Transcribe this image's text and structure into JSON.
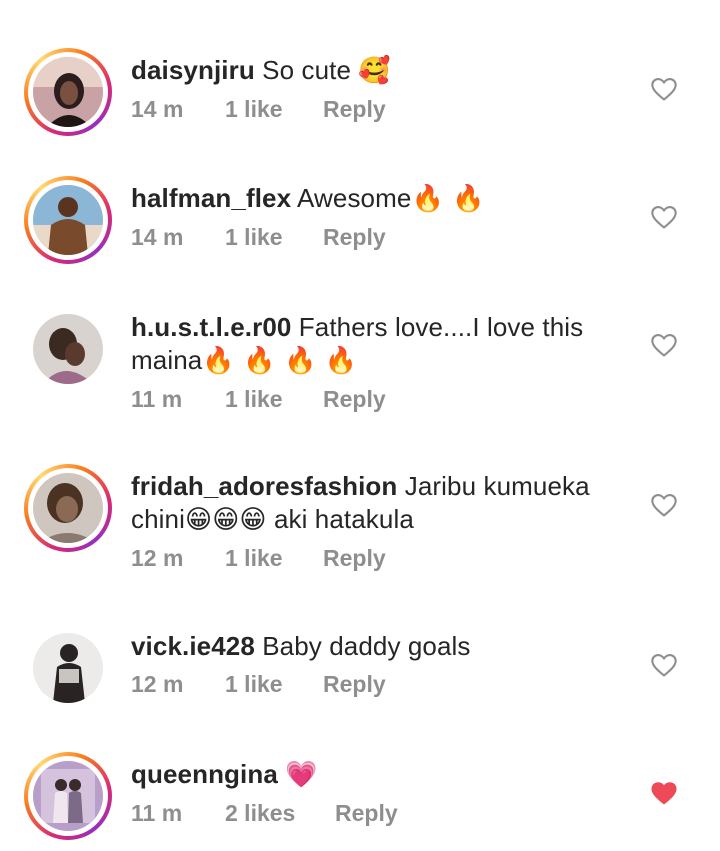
{
  "comments": [
    {
      "username": "daisynjiru",
      "text": "So cute",
      "emoji": "🥰",
      "time": "14 m",
      "likes": "1 like",
      "reply": "Reply",
      "liked": false,
      "avatar_ring": true,
      "avatar_colors": [
        "#c9a2a5",
        "#2b1d1d",
        "#e6d0c8"
      ]
    },
    {
      "username": "halfman_flex",
      "text": "Awesome",
      "emoji": "🔥 🔥",
      "time": "14 m",
      "likes": "1 like",
      "reply": "Reply",
      "liked": false,
      "avatar_ring": true,
      "avatar_colors": [
        "#8bb6d6",
        "#7a4a2c",
        "#e8d9c8"
      ]
    },
    {
      "username": "h.u.s.t.l.e.r00",
      "text": "Fathers love....I love this",
      "text_line2": "maina",
      "emoji": "🔥 🔥 🔥 🔥",
      "time": "11 m",
      "likes": "1 like",
      "reply": "Reply",
      "liked": false,
      "avatar_ring": false,
      "avatar_colors": [
        "#d9d3cf",
        "#3a2a22",
        "#9c6b8a"
      ]
    },
    {
      "username": "fridah_adoresfashion",
      "text": "Jaribu kumueka",
      "text_line2": "chini",
      "emoji": "😁😁😁",
      "text_tail": "aki hatakula",
      "time": "12 m",
      "likes": "1 like",
      "reply": "Reply",
      "liked": false,
      "avatar_ring": true,
      "avatar_colors": [
        "#cfc6bf",
        "#4a3322",
        "#8a7a70"
      ]
    },
    {
      "username": "vick.ie428",
      "text": "Baby daddy goals",
      "time": "12 m",
      "likes": "1 like",
      "reply": "Reply",
      "liked": false,
      "avatar_ring": false,
      "avatar_colors": [
        "#ecebe9",
        "#2a2324",
        "#c8c4c0"
      ]
    },
    {
      "username": "queenngina",
      "emoji": "💗",
      "time": "11 m",
      "likes": "2 likes",
      "reply": "Reply",
      "liked": true,
      "avatar_ring": true,
      "avatar_colors": [
        "#b89fc9",
        "#f0e6ee",
        "#7d6a86"
      ]
    }
  ],
  "colors": {
    "text": "#262626",
    "meta": "#8e8e8e",
    "heart_outline": "#8e8e8e",
    "heart_filled": "#ed4956"
  }
}
